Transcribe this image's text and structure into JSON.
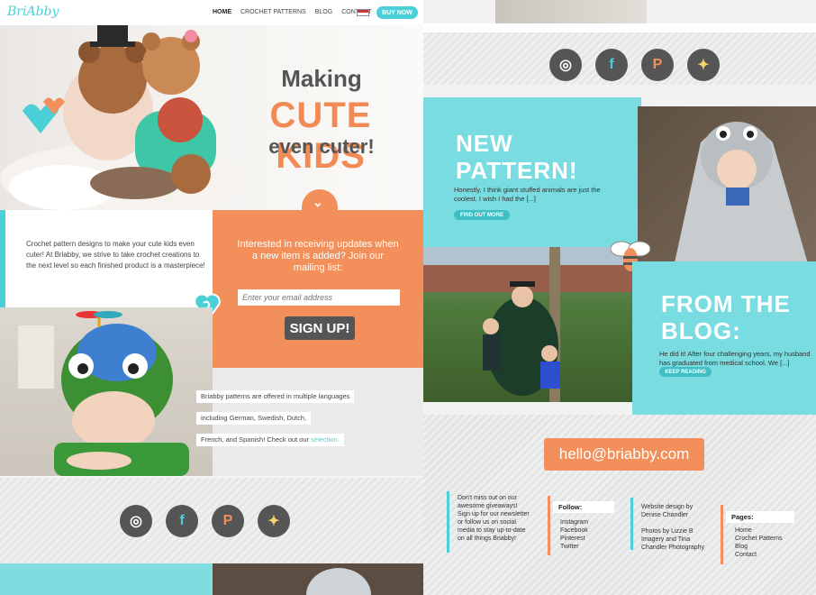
{
  "left_page": {
    "logo": "BriAbby",
    "nav": {
      "links": [
        "HOME",
        "CROCHET PATTERNS",
        "BLOG",
        "CONTACT"
      ],
      "active": "HOME",
      "buy_now": "BUY NOW"
    },
    "hero": {
      "line1": "Making",
      "line2": "CUTE KIDS",
      "line3": "even cuter!"
    },
    "intro_text": "Crochet pattern designs to make your cute kids even cuter! At Briabby, we strive to take crochet creations to the next level so each finished product is a masterpiece!",
    "mailing": {
      "prompt": "Interested in receiving updates when a new item is added? Join our mailing list:",
      "email_placeholder": "Enter your email address",
      "signup_label": "SIGN UP!"
    },
    "languages": {
      "line1": "Briabby patterns are offered in multiple languages",
      "line2": "including German, Swedish, Dutch,",
      "line3": "French, and Spanish! Check out our",
      "link": "selection."
    },
    "social": {
      "instagram": "instagram-icon",
      "facebook": "facebook-icon",
      "pinterest": "pinterest-icon",
      "twitter": "twitter-icon"
    }
  },
  "right_page": {
    "new_pattern": {
      "title_line1": "NEW",
      "title_line2": "PATTERN!",
      "text": "Honestly, I think giant stuffed animals are just the coolest. I wish I had the [...]",
      "button": "FIND OUT MORE"
    },
    "blog": {
      "title_line1": "FROM THE",
      "title_line2": "BLOG:",
      "text": "He did it! After four challenging years, my husband has graduated from medical school. We [...]",
      "button": "KEEP READING"
    },
    "email": "hello@briabby.com",
    "footer": {
      "giveaways": "Don't miss out on our awesome giveaways! Sign up for our newsletter or follow us on social media to stay up-to-date on all things Briabby!",
      "follow_heading": "Follow:",
      "follow_links": [
        "Instagram",
        "Facebook",
        "Pinterest",
        "Twitter"
      ],
      "credit1": "Website design by Denise Chandler",
      "credit2": "Photos by Lizzie B Imagery and Tina Chandler Photography",
      "pages_heading": "Pages:",
      "pages_links": [
        "Home",
        "Crochet Patterns",
        "Blog",
        "Contact"
      ]
    }
  },
  "colors": {
    "teal": "#4ad0d6",
    "orange": "#f28f5a",
    "dark": "#555555",
    "yellow": "#f7d46a"
  }
}
